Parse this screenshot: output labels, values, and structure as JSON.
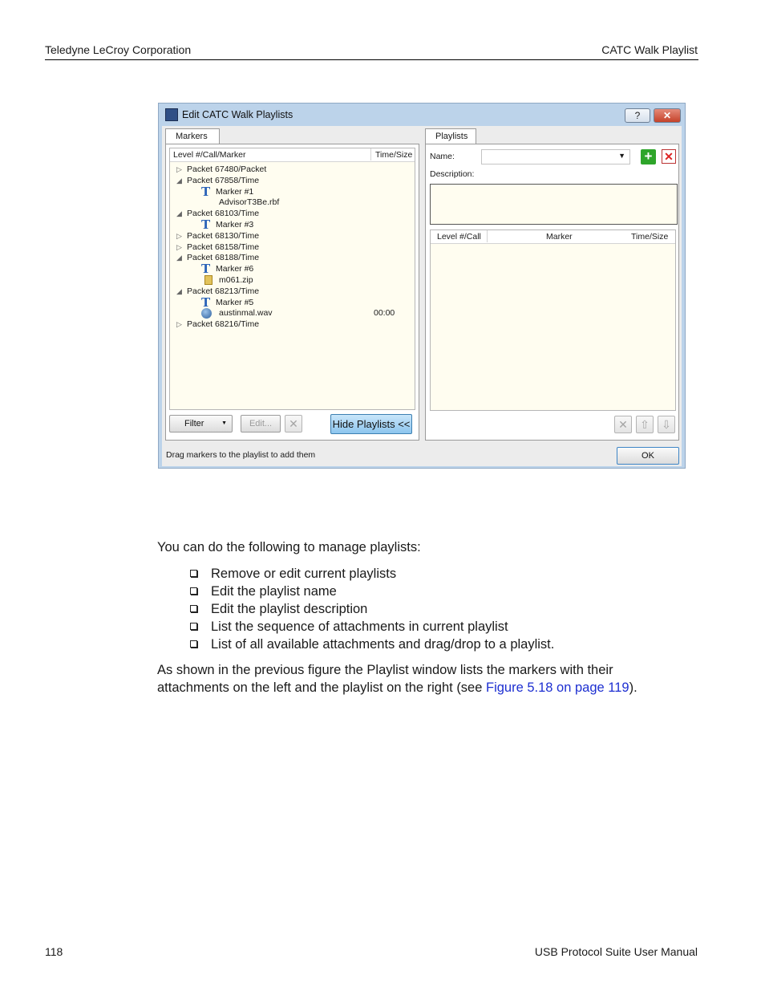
{
  "page": {
    "header_left": "Teledyne LeCroy Corporation",
    "header_right": "CATC Walk Playlist",
    "footer_left": "118",
    "footer_right": "USB Protocol Suite User Manual"
  },
  "dialog": {
    "title": "Edit CATC Walk Playlists",
    "help_label": "?",
    "close_label": "✕",
    "left": {
      "tab": "Markers",
      "col_level": "Level #/Call/Marker",
      "col_time": "Time/Size",
      "tree": [
        {
          "label": "Packet 67480/Packet",
          "type": "packet",
          "expanded": false
        },
        {
          "label": "Packet 67858/Time",
          "type": "packet",
          "expanded": true
        },
        {
          "label": "Marker #1",
          "type": "marker"
        },
        {
          "label": "AdvisorT3Be.rbf",
          "type": "file"
        },
        {
          "label": "Packet 68103/Time",
          "type": "packet",
          "expanded": true
        },
        {
          "label": "Marker #3",
          "type": "marker"
        },
        {
          "label": "Packet 68130/Time",
          "type": "packet",
          "expanded": false
        },
        {
          "label": "Packet 68158/Time",
          "type": "packet",
          "expanded": false
        },
        {
          "label": "Packet 68188/Time",
          "type": "packet",
          "expanded": true
        },
        {
          "label": "Marker #6",
          "type": "marker"
        },
        {
          "label": "m061.zip",
          "type": "zip"
        },
        {
          "label": "Packet 68213/Time",
          "type": "packet",
          "expanded": true
        },
        {
          "label": "Marker #5",
          "type": "marker"
        },
        {
          "label": "austinmal.wav",
          "type": "wav",
          "time": "00:00"
        },
        {
          "label": "Packet 68216/Time",
          "type": "packet",
          "expanded": false
        }
      ],
      "filter_label": "Filter",
      "edit_label": "Edit...",
      "hide_label": "Hide Playlists <<"
    },
    "right": {
      "tab": "Playlists",
      "name_label": "Name:",
      "description_label": "Description:",
      "col_level": "Level #/Call",
      "col_marker": "Marker",
      "col_time": "Time/Size"
    },
    "status": "Drag markers to the playlist to add them",
    "ok_label": "OK"
  },
  "body": {
    "intro": "You can do the following to manage playlists:",
    "bullets": [
      "Remove or edit current playlists",
      "Edit the playlist name",
      "Edit the playlist description",
      "List the sequence of attachments in current playlist",
      "List of all available attachments and drag/drop to a playlist."
    ],
    "para_line1": "As shown in the previous figure the Playlist window lists the markers with their",
    "para_line2_pre": "attachments on the left and the playlist on the right (see ",
    "para_link": "Figure 5.18 on page 119",
    "para_line2_post": ")."
  }
}
